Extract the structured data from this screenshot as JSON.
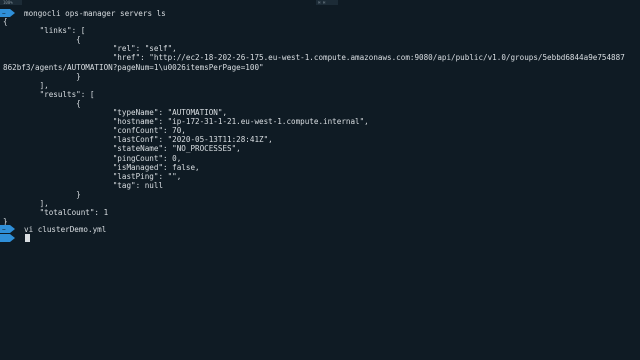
{
  "status_bar": {
    "left_label": "100%",
    "right_label": "⌘ ⌘ "
  },
  "terminal": {
    "command_1": "mongocli ops-manager servers ls",
    "output_lines": [
      "{",
      "        \"links\": [",
      "                {",
      "                        \"rel\": \"self\",",
      "                        \"href\": \"http://ec2-18-202-26-175.eu-west-1.compute.amazonaws.com:9080/api/public/v1.0/groups/5ebbd6844a9e754887",
      "862bf3/agents/AUTOMATION?pageNum=1\\u0026itemsPerPage=100\"",
      "                }",
      "        ],",
      "        \"results\": [",
      "                {",
      "                        \"typeName\": \"AUTOMATION\",",
      "                        \"hostname\": \"ip-172-31-1-21.eu-west-1.compute.internal\",",
      "                        \"confCount\": 70,",
      "                        \"lastConf\": \"2020-05-13T11:28:41Z\",",
      "                        \"stateName\": \"NO_PROCESSES\",",
      "                        \"pingCount\": 0,",
      "                        \"isManaged\": false,",
      "                        \"lastPing\": \"\",",
      "                        \"tag\": null",
      "                }",
      "        ],",
      "        \"totalCount\": 1",
      "}"
    ],
    "command_2": "vi clusterDemo.yml"
  },
  "colors": {
    "background": "#0f1b24",
    "text": "#d9dee2",
    "prompt_blue": "#2f8fd8"
  }
}
